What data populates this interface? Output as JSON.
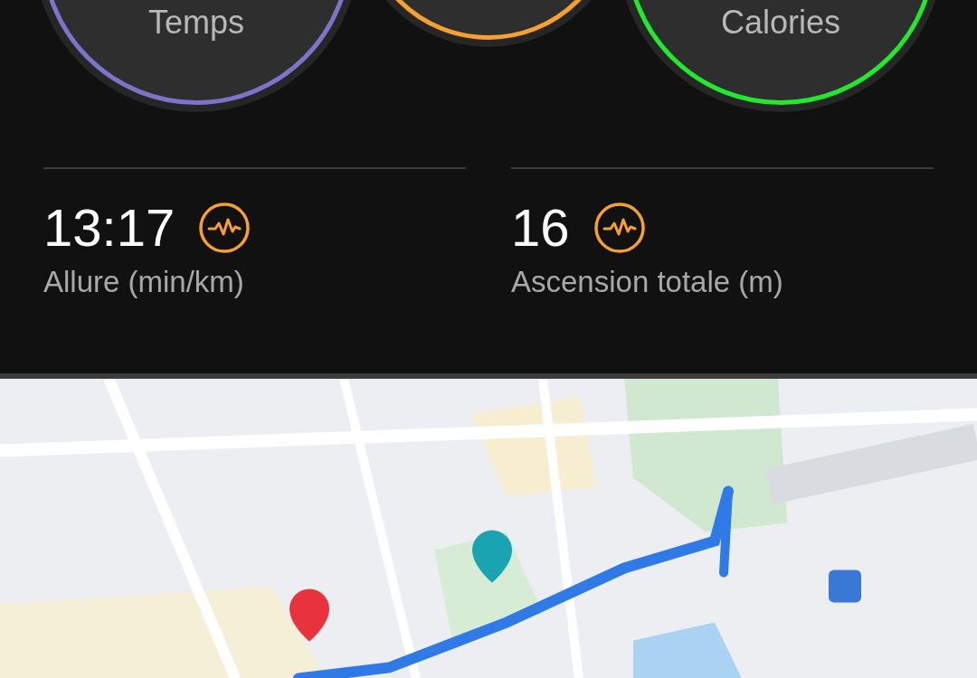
{
  "rings": [
    {
      "label": "Temps",
      "color": "#7b74c9"
    },
    {
      "color": "#f5a030"
    },
    {
      "label": "Calories",
      "color": "#22e830"
    }
  ],
  "stats": [
    {
      "value": "13:17",
      "label": "Allure (min/km)"
    },
    {
      "value": "16",
      "label": "Ascension totale (m)"
    }
  ]
}
